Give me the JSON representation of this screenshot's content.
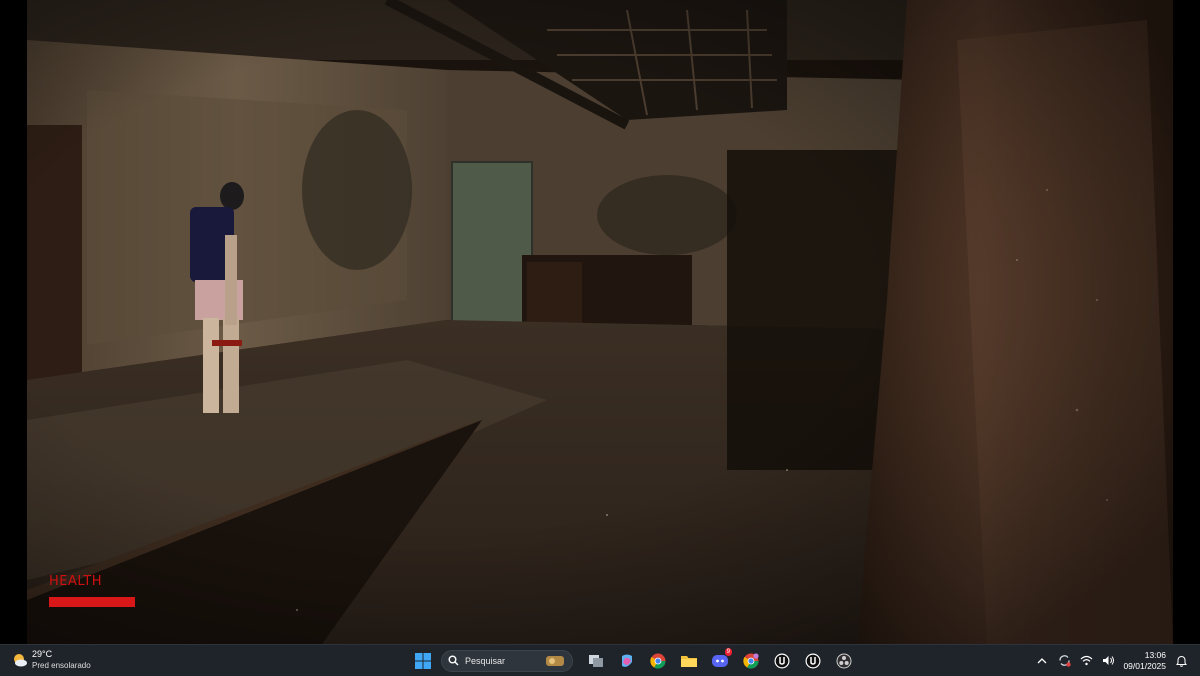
{
  "hud": {
    "health_label": "HEALTH",
    "health_fraction": 1.0,
    "health_color": "#d81818"
  },
  "taskbar": {
    "weather": {
      "temperature": "29°C",
      "description": "Pred ensolarado",
      "icon": "sun-cloud-icon"
    },
    "search_placeholder": "Pesquisar",
    "pinned_icons": [
      "windows-start-icon",
      "search-icon",
      "task-view-icon",
      "copilot-icon",
      "chrome-icon",
      "file-explorer-icon",
      "discord-icon",
      "chrome-profile-icon",
      "unreal-engine-icon",
      "unreal-engine-icon-2",
      "obs-icon"
    ],
    "discord_badge": "9",
    "clock": {
      "time": "13:06",
      "date": "09/01/2025"
    }
  }
}
